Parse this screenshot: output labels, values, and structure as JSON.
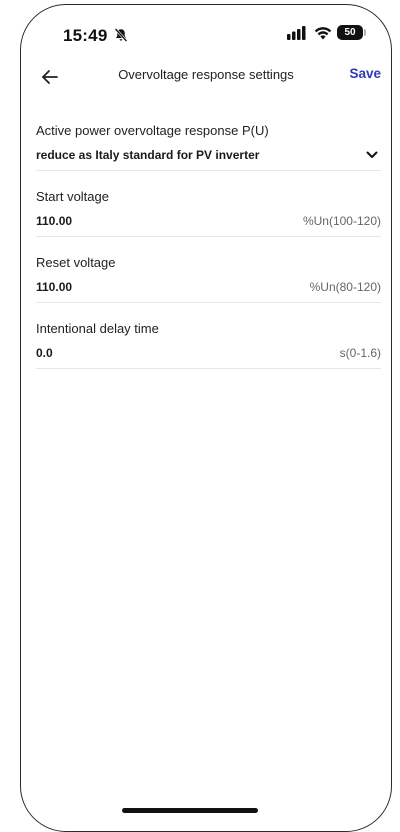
{
  "status_bar": {
    "time": "15:49",
    "battery": "50",
    "icons": [
      "bell-slash-icon",
      "signal-icon",
      "wifi-icon",
      "battery-icon"
    ]
  },
  "nav": {
    "back_icon": "arrow-left-icon",
    "title": "Overvoltage response settings",
    "save_label": "Save",
    "save_color": "#2b3bb8"
  },
  "fields": [
    {
      "label": "Active power overvoltage response P(U)",
      "value": "reduce as Italy standard for PV inverter",
      "type": "dropdown",
      "icon": "chevron-down-icon"
    },
    {
      "label": "Start voltage",
      "value": "110.00",
      "unit": "%Un(100-120)",
      "type": "input"
    },
    {
      "label": "Reset voltage",
      "value": "110.00",
      "unit": "%Un(80-120)",
      "type": "input"
    },
    {
      "label": "Intentional delay time",
      "value": "0.0",
      "unit": "s(0-1.6)",
      "type": "input"
    }
  ]
}
